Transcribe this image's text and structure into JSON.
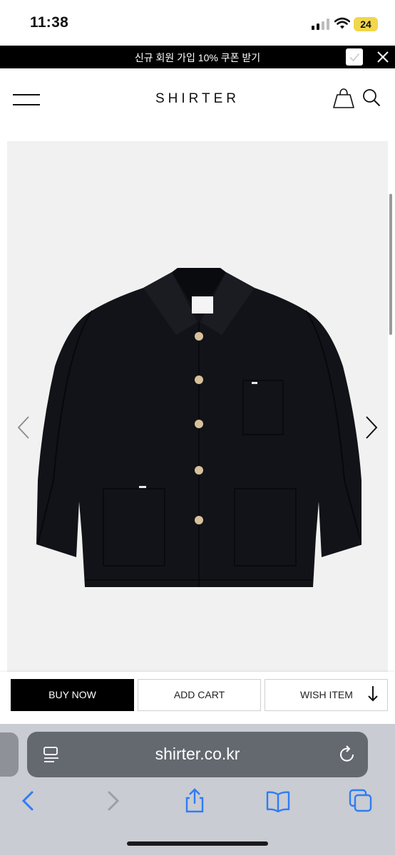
{
  "status_bar": {
    "time": "11:38",
    "battery": "24"
  },
  "promo": {
    "text": "신규 회원 가입 10% 쿠폰 받기"
  },
  "header": {
    "logo": "SHIRTER"
  },
  "product": {
    "image_alt": "black work jacket with wooden buttons"
  },
  "actions": {
    "buy_now": "BUY NOW",
    "add_cart": "ADD CART",
    "wish_item": "WISH ITEM"
  },
  "browser": {
    "url": "shirter.co.kr"
  },
  "colors": {
    "accent": "#000000",
    "browser_bar": "#64686f",
    "browser_bg": "#c9ccd2",
    "ios_blue": "#2f7cf6",
    "battery": "#f2d64b"
  },
  "icons": [
    "signal-icon",
    "wifi-icon",
    "checkbox-icon",
    "close-icon",
    "menu-icon",
    "shopping-bag-icon",
    "search-icon",
    "chevron-left-icon",
    "chevron-right-icon",
    "arrow-down-icon",
    "reader-icon",
    "reload-icon",
    "back-icon",
    "forward-icon",
    "share-icon",
    "bookmarks-icon",
    "tabs-icon"
  ]
}
